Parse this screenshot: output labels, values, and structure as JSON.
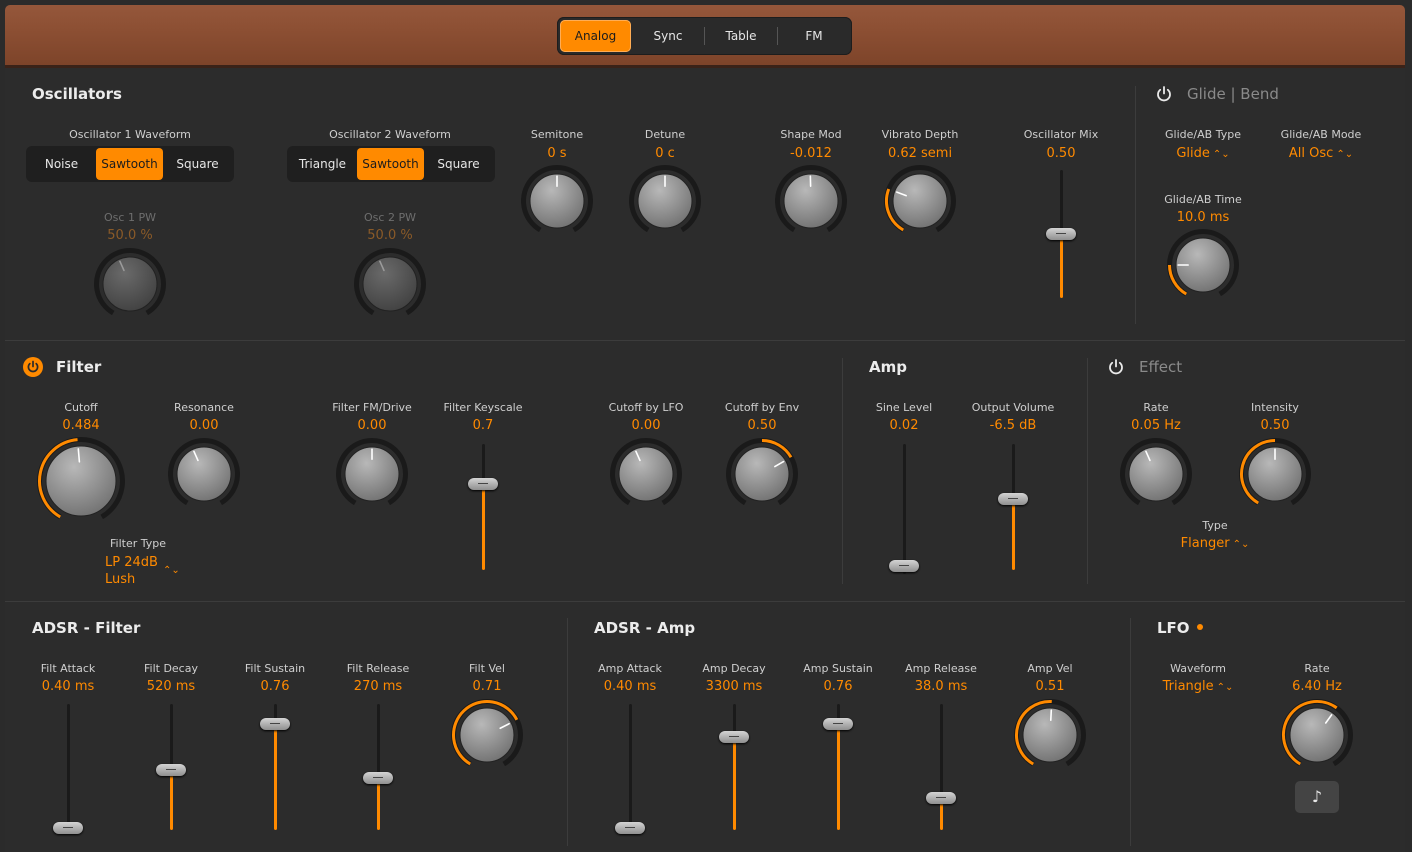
{
  "tabs": [
    "Analog",
    "Sync",
    "Table",
    "FM"
  ],
  "active_tab": "Analog",
  "colors": {
    "accent": "#ff8a00",
    "background": "#2c2c2c",
    "wood": "#8c4f33"
  },
  "oscillators": {
    "title": "Oscillators",
    "osc1_waveform": {
      "label": "Oscillator 1 Waveform",
      "options": [
        "Noise",
        "Sawtooth",
        "Square"
      ],
      "selected": "Sawtooth"
    },
    "osc2_waveform": {
      "label": "Oscillator 2 Waveform",
      "options": [
        "Triangle",
        "Sawtooth",
        "Square"
      ],
      "selected": "Sawtooth"
    },
    "osc1_pw": {
      "label": "Osc 1 PW",
      "value": "50.0 %"
    },
    "osc2_pw": {
      "label": "Osc 2 PW",
      "value": "50.0 %"
    },
    "semitone": {
      "label": "Semitone",
      "value": "0 s"
    },
    "detune": {
      "label": "Detune",
      "value": "0 c"
    },
    "shape_mod": {
      "label": "Shape Mod",
      "value": "-0.012"
    },
    "vibrato_depth": {
      "label": "Vibrato Depth",
      "value": "0.62 semi"
    },
    "osc_mix": {
      "label": "Oscillator Mix",
      "value": "0.50"
    }
  },
  "glide": {
    "title": "Glide | Bend",
    "type": {
      "label": "Glide/AB Type",
      "value": "Glide"
    },
    "mode": {
      "label": "Glide/AB Mode",
      "value": "All Osc"
    },
    "time": {
      "label": "Glide/AB Time",
      "value": "10.0 ms"
    }
  },
  "filter": {
    "title": "Filter",
    "cutoff": {
      "label": "Cutoff",
      "value": "0.484"
    },
    "resonance": {
      "label": "Resonance",
      "value": "0.00"
    },
    "fm_drive": {
      "label": "Filter FM/Drive",
      "value": "0.00"
    },
    "keyscale": {
      "label": "Filter Keyscale",
      "value": "0.7"
    },
    "cutoff_lfo": {
      "label": "Cutoff by LFO",
      "value": "0.00"
    },
    "cutoff_env": {
      "label": "Cutoff by Env",
      "value": "0.50"
    },
    "type": {
      "label": "Filter Type",
      "value_line1": "LP 24dB",
      "value_line2": "Lush"
    }
  },
  "amp": {
    "title": "Amp",
    "sine_level": {
      "label": "Sine Level",
      "value": "0.02"
    },
    "output_volume": {
      "label": "Output Volume",
      "value": "-6.5 dB"
    }
  },
  "effect": {
    "title": "Effect",
    "rate": {
      "label": "Rate",
      "value": "0.05 Hz"
    },
    "intensity": {
      "label": "Intensity",
      "value": "0.50"
    },
    "type": {
      "label": "Type",
      "value": "Flanger"
    }
  },
  "adsr_filter": {
    "title": "ADSR - Filter",
    "attack": {
      "label": "Filt Attack",
      "value": "0.40 ms"
    },
    "decay": {
      "label": "Filt Decay",
      "value": "520 ms"
    },
    "sustain": {
      "label": "Filt Sustain",
      "value": "0.76"
    },
    "release": {
      "label": "Filt Release",
      "value": "270 ms"
    },
    "vel": {
      "label": "Filt Vel",
      "value": "0.71"
    }
  },
  "adsr_amp": {
    "title": "ADSR - Amp",
    "attack": {
      "label": "Amp Attack",
      "value": "0.40 ms"
    },
    "decay": {
      "label": "Amp Decay",
      "value": "3300 ms"
    },
    "sustain": {
      "label": "Amp Sustain",
      "value": "0.76"
    },
    "release": {
      "label": "Amp Release",
      "value": "38.0 ms"
    },
    "vel": {
      "label": "Amp Vel",
      "value": "0.51"
    }
  },
  "lfo": {
    "title": "LFO",
    "waveform": {
      "label": "Waveform",
      "value": "Triangle"
    },
    "rate": {
      "label": "Rate",
      "value": "6.40 Hz"
    },
    "note_icon": "music-note-icon"
  }
}
